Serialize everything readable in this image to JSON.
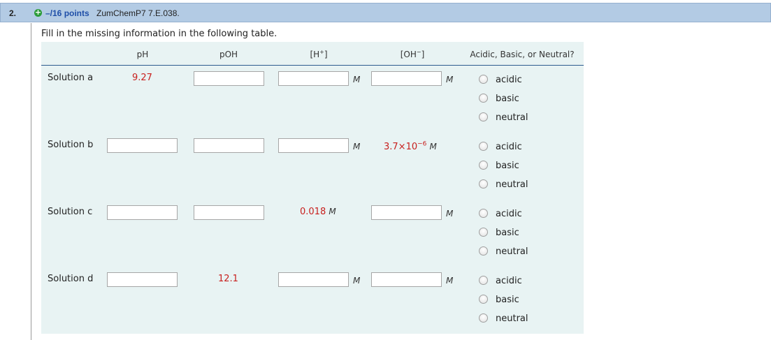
{
  "question": {
    "number": "2.",
    "points": "–/16 points",
    "reference": "ZumChemP7 7.E.038."
  },
  "instructions": "Fill in the missing information in the following table.",
  "table": {
    "headers": {
      "ph": "pH",
      "poh": "pOH",
      "h_base": "[H",
      "h_sup": "+",
      "h_close": "]",
      "oh_base": "[OH",
      "oh_sup": "−",
      "oh_close": "]",
      "type": "Acidic, Basic, or Neutral?"
    },
    "unit": "M",
    "options": [
      "acidic",
      "basic",
      "neutral"
    ],
    "rows": [
      {
        "label": "Solution a",
        "ph": "9.27"
      },
      {
        "label": "Solution b",
        "oh_mantissa": "3.7×10",
        "oh_exp": "−6"
      },
      {
        "label": "Solution c",
        "h": "0.018"
      },
      {
        "label": "Solution d",
        "poh": "12.1"
      }
    ]
  }
}
